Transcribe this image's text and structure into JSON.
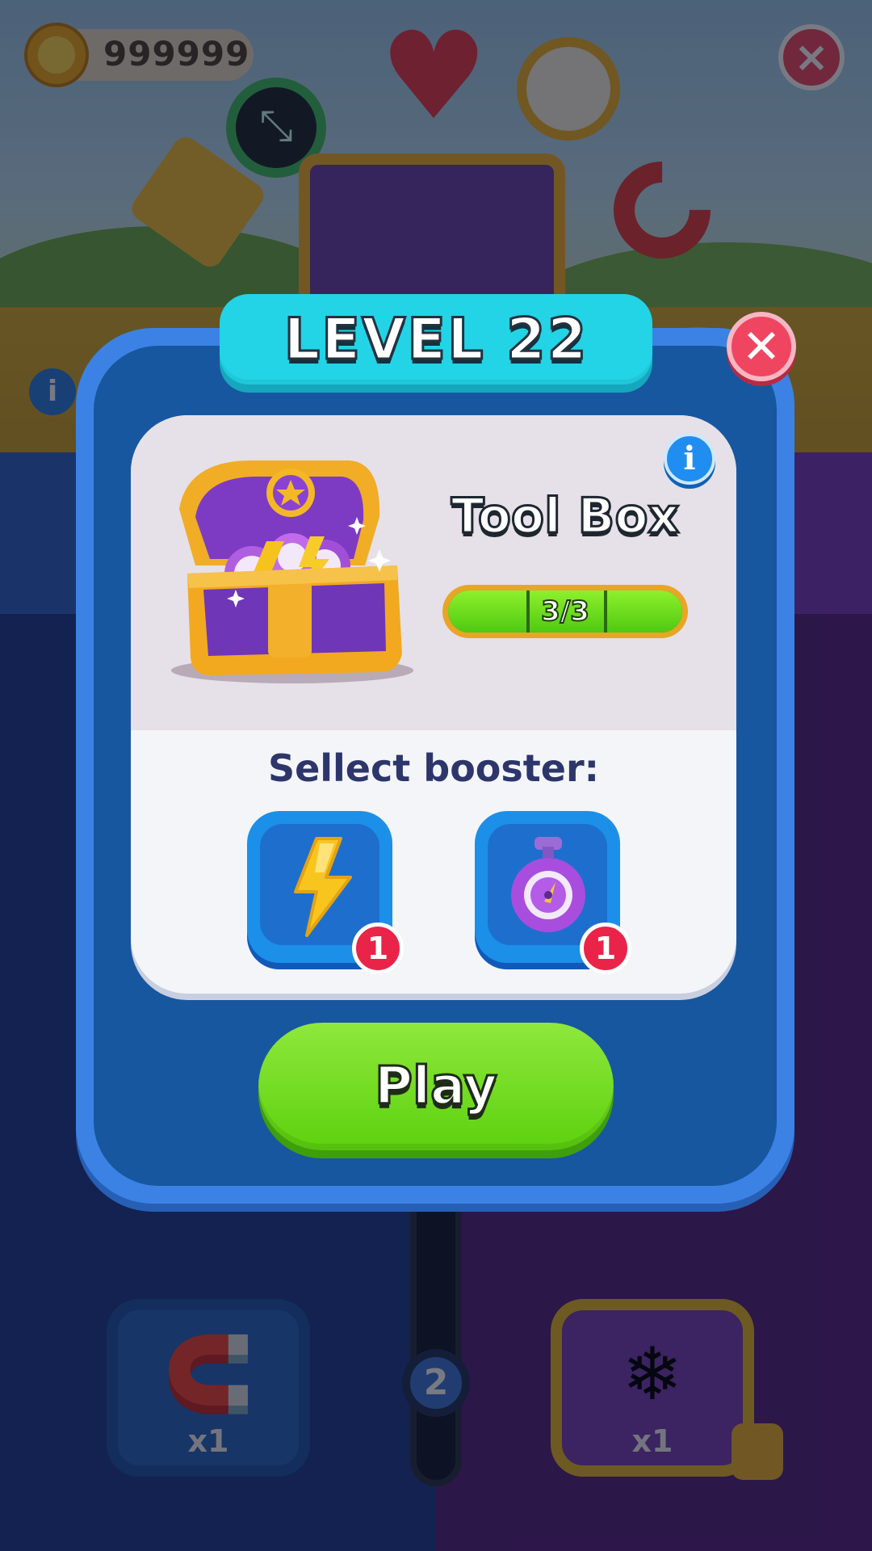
{
  "background": {
    "coins_value": "999999",
    "tile_left_label": "x1",
    "tile_right_label": "x1",
    "track_node_label": "2"
  },
  "modal": {
    "level_title": "LEVEL 22",
    "close_icon": "close-icon",
    "info_icon_label": "i",
    "reward": {
      "name": "Tool Box",
      "icon": "treasure-chest-icon",
      "progress_label": "3/3",
      "progress_fraction": 1.0,
      "segments": 3
    },
    "select_label": "Sellect booster:",
    "boosters": [
      {
        "icon": "lightning-bolt-icon",
        "count": "1"
      },
      {
        "icon": "stopwatch-icon",
        "count": "1"
      }
    ],
    "play_label": "Play"
  },
  "colors": {
    "modal_blue": "#17579f",
    "banner_cyan": "#22d4e6",
    "play_green": "#5cd10e",
    "badge_red": "#ea2448",
    "close_red": "#ef4561"
  }
}
